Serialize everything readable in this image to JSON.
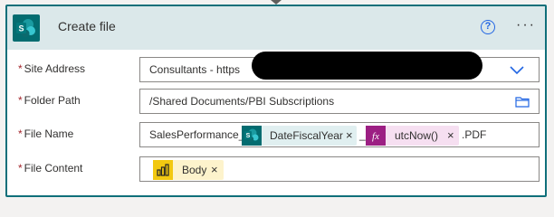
{
  "header": {
    "title": "Create file",
    "help_icon": "question-circle-icon",
    "more_icon": "ellipsis-icon",
    "help_glyph": "?",
    "more_glyph": "···"
  },
  "fields": {
    "site_address": {
      "label": "Site Address",
      "value": "Consultants - https"
    },
    "folder_path": {
      "label": "Folder Path",
      "value": "/Shared Documents/PBI Subscriptions"
    },
    "file_name": {
      "label": "File Name",
      "prefix": "SalesPerformance_",
      "token1": "DateFiscalYear",
      "separator": "_",
      "token2": "utcNow()",
      "suffix": ".PDF"
    },
    "file_content": {
      "label": "File Content",
      "token": "Body"
    }
  },
  "required_marker": "*",
  "close_glyph": "×",
  "colors": {
    "header_bg": "#dbe8ea",
    "card_border": "#0f6f7a",
    "sharepoint": "#036c70",
    "expression": "#9c1f83",
    "expression_token_bg": "#f6dff1",
    "sp_token_bg": "#e0eff0",
    "powerbi": "#f2c811",
    "powerbi_token_bg": "#fdf3cc",
    "required": "#a4262c",
    "accent": "#2266e3"
  }
}
